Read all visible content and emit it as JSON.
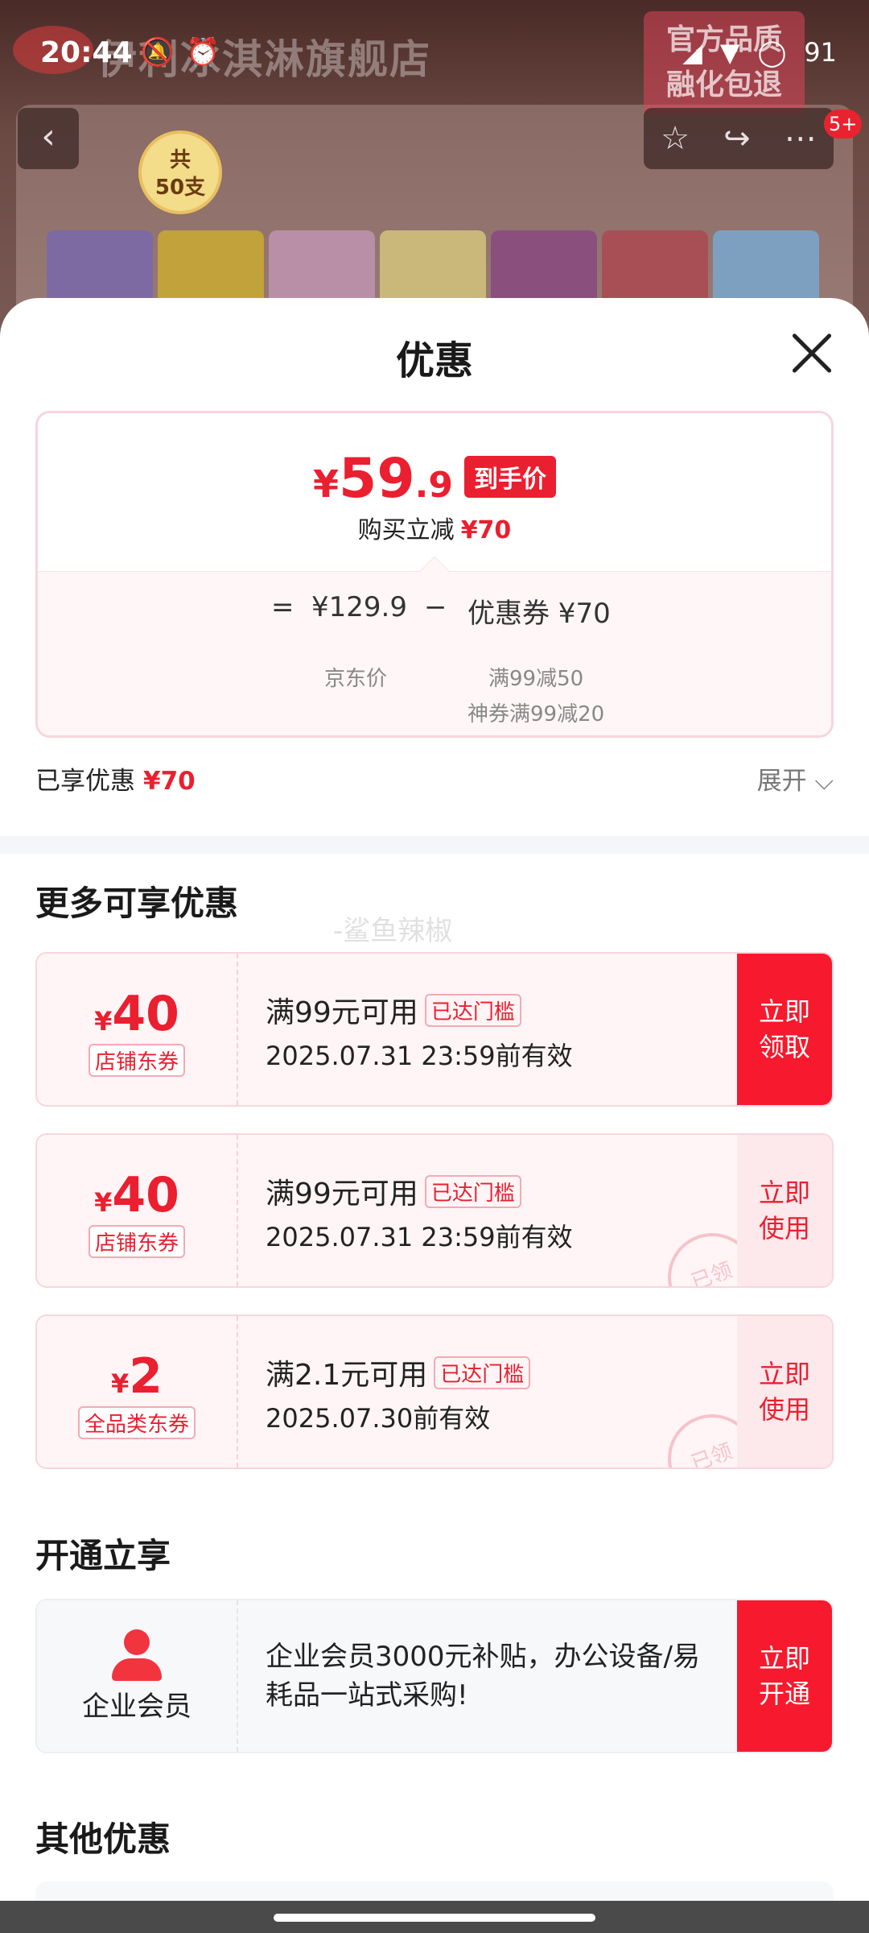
{
  "status_bar": {
    "time": "20:44",
    "battery": "91",
    "icons": [
      "mute-icon",
      "alarm-icon",
      "signal-icon",
      "wifi-icon",
      "battery-icon"
    ]
  },
  "background_page": {
    "store_title": "伊利冰淇淋旗舰店",
    "promo_line1": "官方品质",
    "promo_line2": "融化包退",
    "cart_badge": "5+",
    "pack_badge_line1": "共",
    "pack_badge_line2": "50支"
  },
  "sheet": {
    "title": "优惠",
    "price": {
      "currency": "¥",
      "integer": "59",
      "decimal": ".9",
      "tag": "到手价",
      "saving_label": "购买立减",
      "saving_value": "¥70"
    },
    "formula": {
      "equals": "=",
      "jd_price": "¥129.9",
      "minus": "−",
      "coupon_total": "优惠券 ¥70",
      "jd_label": "京东价",
      "coupon_detail_1": "满99减50",
      "coupon_detail_2": "神券满99减20"
    },
    "enjoyed_label": "已享优惠",
    "enjoyed_value": "¥70",
    "expand_label": "展开 ⌵"
  },
  "more_section": {
    "title": "更多可享优惠",
    "watermark": "-鲨鱼辣椒",
    "coupons": [
      {
        "currency": "¥",
        "amount": "40",
        "kind": "店铺东券",
        "condition": "满99元可用",
        "reached": "已达门槛",
        "validity": "2025.07.31 23:59前有效",
        "action_line1": "立即",
        "action_line2": "领取"
      },
      {
        "currency": "¥",
        "amount": "40",
        "kind": "店铺东券",
        "condition": "满99元可用",
        "reached": "已达门槛",
        "validity": "2025.07.31 23:59前有效",
        "action_line1": "立即",
        "action_line2": "使用",
        "stamp": "已领"
      },
      {
        "currency": "¥",
        "amount": "2",
        "kind": "全品类东券",
        "condition": "满2.1元可用",
        "reached": "已达门槛",
        "validity": "2025.07.30前有效",
        "action_line1": "立即",
        "action_line2": "使用",
        "stamp": "已领"
      }
    ]
  },
  "open_section": {
    "title": "开通立享",
    "member_label": "企业会员",
    "member_desc": "企业会员3000元补贴，办公设备/易耗品一站式采购!",
    "action_line1": "立即",
    "action_line2": "开通"
  },
  "other_section": {
    "title": "其他优惠"
  },
  "colors": {
    "accent_red": "#ea1f2f",
    "button_red": "#f7192d",
    "coupon_bg": "#fff5f6"
  }
}
